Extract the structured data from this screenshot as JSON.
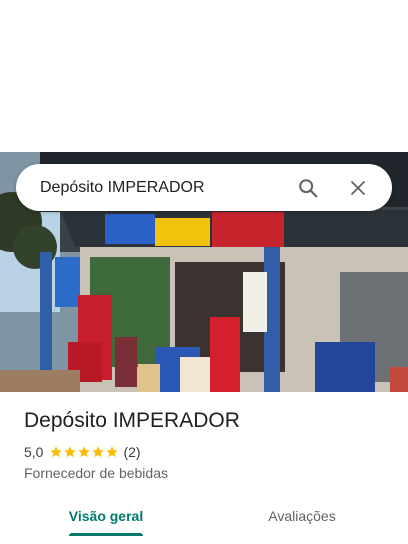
{
  "search": {
    "query": "Depósito IMPERADOR"
  },
  "place": {
    "name": "Depósito IMPERADOR",
    "rating": "5,0",
    "stars": 5,
    "review_count": "(2)",
    "category": "Fornecedor de bebidas"
  },
  "tabs": [
    {
      "label": "Visão geral",
      "active": true
    },
    {
      "label": "Avaliações",
      "active": false
    }
  ],
  "colors": {
    "accent": "#00796b",
    "star": "#fbbc04",
    "text": "#202124"
  },
  "icons": {
    "search": "search-icon",
    "close": "close-icon",
    "star": "star-icon"
  }
}
